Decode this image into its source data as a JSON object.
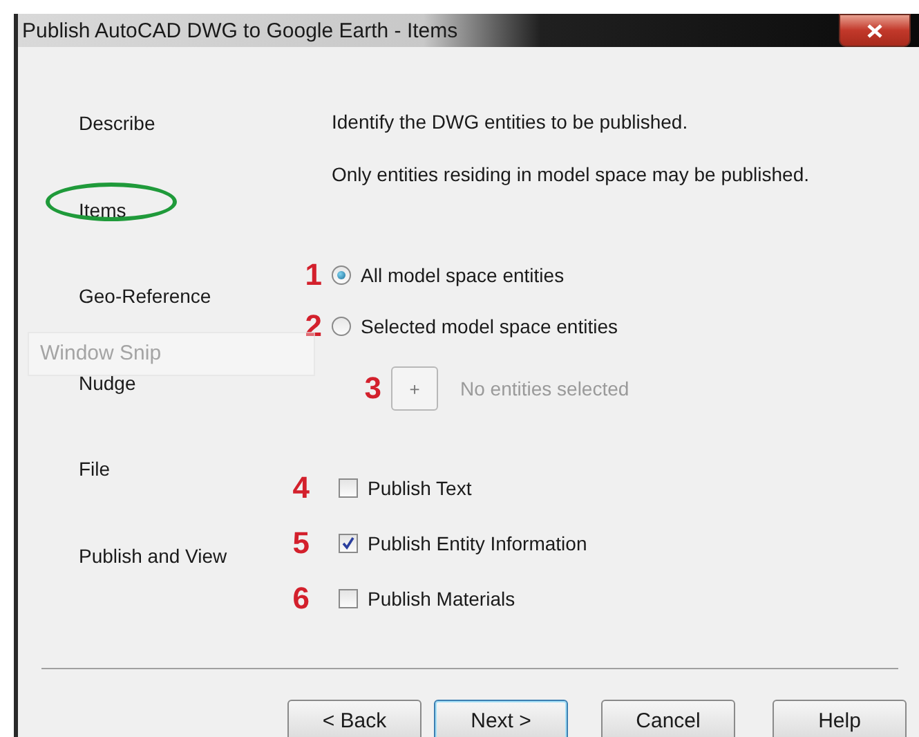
{
  "window": {
    "title": "Publish AutoCAD DWG to Google Earth - Items"
  },
  "nav": [
    {
      "label": "Describe",
      "circled": false
    },
    {
      "label": "Items",
      "circled": true
    },
    {
      "label": "Geo-Reference",
      "circled": false
    },
    {
      "label": "Nudge",
      "circled": false
    },
    {
      "label": "File",
      "circled": false
    },
    {
      "label": "Publish and View",
      "circled": false
    }
  ],
  "intro": [
    "Identify the DWG entities to be published.",
    "Only entities residing in model space may be published."
  ],
  "options": [
    {
      "kind": "radio",
      "marker": "1",
      "label": "All model space entities",
      "selected": true
    },
    {
      "kind": "radio",
      "marker": "2",
      "label": "Selected model space entities",
      "selected": false
    },
    {
      "kind": "nudge",
      "marker": "3",
      "button": "+",
      "label": "No entities selected",
      "disabled": true
    },
    {
      "kind": "checkbox",
      "marker": "4",
      "label": "Publish Text",
      "checked": false
    },
    {
      "kind": "checkbox",
      "marker": "5",
      "label": "Publish Entity Information",
      "checked": true
    },
    {
      "kind": "checkbox",
      "marker": "6",
      "label": "Publish Materials",
      "checked": false
    }
  ],
  "buttons": [
    {
      "label": "< Back",
      "default": false
    },
    {
      "label": "Next >",
      "default": true
    },
    {
      "label": "Cancel",
      "default": false
    },
    {
      "label": "Help",
      "default": false
    }
  ],
  "overlay_label": "Window Snip"
}
